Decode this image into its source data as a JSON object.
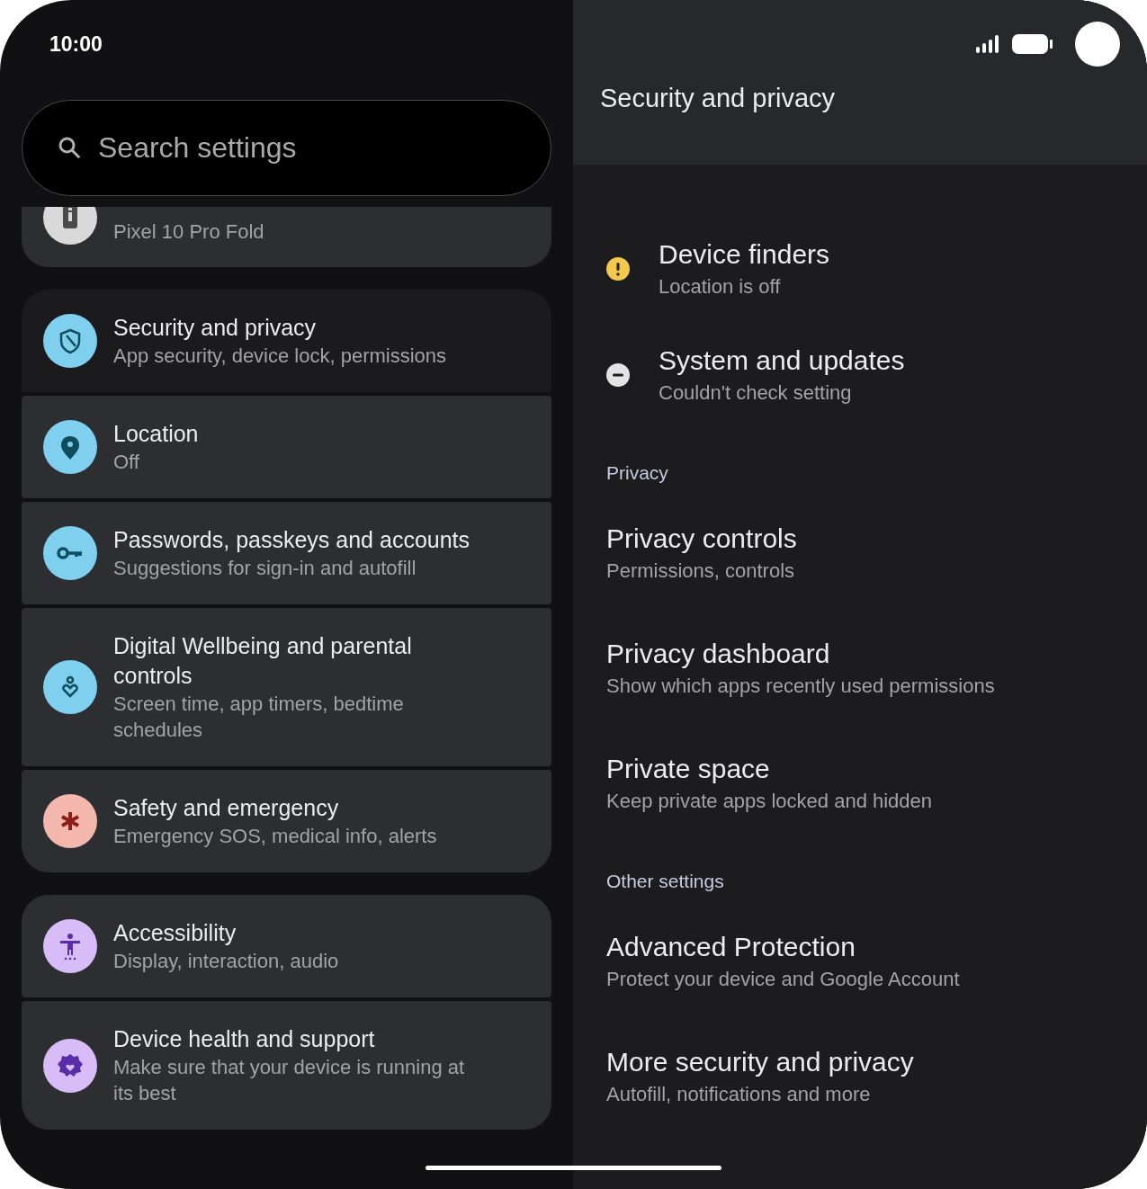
{
  "status_bar": {
    "time": "10:00"
  },
  "search": {
    "placeholder": "Search settings"
  },
  "settings_groups": [
    {
      "items": [
        {
          "kind": "info",
          "color": "#d9d9d9",
          "subtitle": "Pixel 10 Pro Fold",
          "selected": false,
          "clipped": true
        }
      ]
    },
    {
      "items": [
        {
          "kind": "shield",
          "color": "#7fd0ee",
          "title": "Security and privacy",
          "subtitle": "App security, device lock, permissions",
          "selected": true
        },
        {
          "kind": "pin",
          "color": "#7fd0ee",
          "title": "Location",
          "subtitle": "Off",
          "selected": false
        },
        {
          "kind": "key",
          "color": "#7fd0ee",
          "title": "Passwords, passkeys and accounts",
          "subtitle": "Suggestions for sign-in and autofill",
          "selected": false
        },
        {
          "kind": "wellbeing",
          "color": "#7fd0ee",
          "title": "Digital Wellbeing and parental controls",
          "subtitle": "Screen time, app timers, bedtime schedules",
          "selected": false
        },
        {
          "kind": "asterisk",
          "color": "#f4b7ae",
          "title": "Safety and emergency",
          "subtitle": "Emergency SOS, medical info, alerts",
          "selected": false
        }
      ]
    },
    {
      "items": [
        {
          "kind": "accessibility",
          "color": "#d7bcf8",
          "title": "Accessibility",
          "subtitle": "Display, interaction, audio",
          "selected": false
        },
        {
          "kind": "health",
          "color": "#d7bcf8",
          "title": "Device health and support",
          "subtitle": "Make sure that your device is running at its best",
          "selected": false
        }
      ]
    }
  ],
  "detail": {
    "title": "Security and privacy",
    "status_items": [
      {
        "kind": "warning",
        "title": "Device finders",
        "subtitle": "Location is off"
      },
      {
        "kind": "unknown",
        "title": "System and updates",
        "subtitle": "Couldn't check setting"
      }
    ],
    "sections": [
      {
        "heading": "Privacy",
        "items": [
          {
            "title": "Privacy controls",
            "subtitle": "Permissions, controls"
          },
          {
            "title": "Privacy dashboard",
            "subtitle": "Show which apps recently used permissions"
          },
          {
            "title": "Private space",
            "subtitle": "Keep private apps locked and hidden"
          }
        ]
      },
      {
        "heading": "Other settings",
        "items": [
          {
            "title": "Advanced Protection",
            "subtitle": "Protect your device and Google Account"
          },
          {
            "title": "More security and privacy",
            "subtitle": "Autofill, notifications and more"
          }
        ]
      }
    ]
  }
}
